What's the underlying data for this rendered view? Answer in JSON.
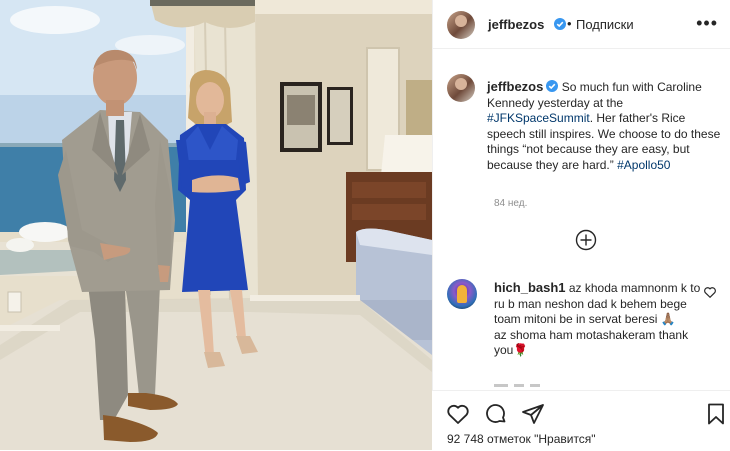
{
  "header": {
    "username": "jeffbezos",
    "separator": "•",
    "follow_label": "Подписки",
    "more_label": "•••"
  },
  "caption": {
    "username": "jeffbezos",
    "text_1": "So much fun with Caroline Kennedy yesterday at the",
    "hashtag_1": "#JFKSpaceSummit",
    "text_2": ". Her father's Rice speech still inspires. We choose to do these things “not because they are easy, but because they are hard.”",
    "hashtag_2": "#Apollo50",
    "time": "84 нед."
  },
  "comment": {
    "username": "hich_bash1",
    "line_1": "az khoda mamnonm k to ru b man neshon dad k behem bege toam mitoni be in servat beresi",
    "emoji_1": "🙏🏽",
    "line_2": "az shoma ham motashakeram thank you",
    "emoji_2": "🌹"
  },
  "actions": {
    "likes_text": "92 748 отметок \"Нравится\""
  },
  "icons": {
    "like": "heart-icon",
    "comment": "comment-icon",
    "share": "share-icon",
    "save": "bookmark-icon",
    "load_more": "plus-circle-icon",
    "verified": "verified-badge-icon"
  },
  "colors": {
    "link": "#00376b",
    "verified": "#3897f0",
    "dress": "#2146b8",
    "secondary_text": "#8e8e8e"
  }
}
